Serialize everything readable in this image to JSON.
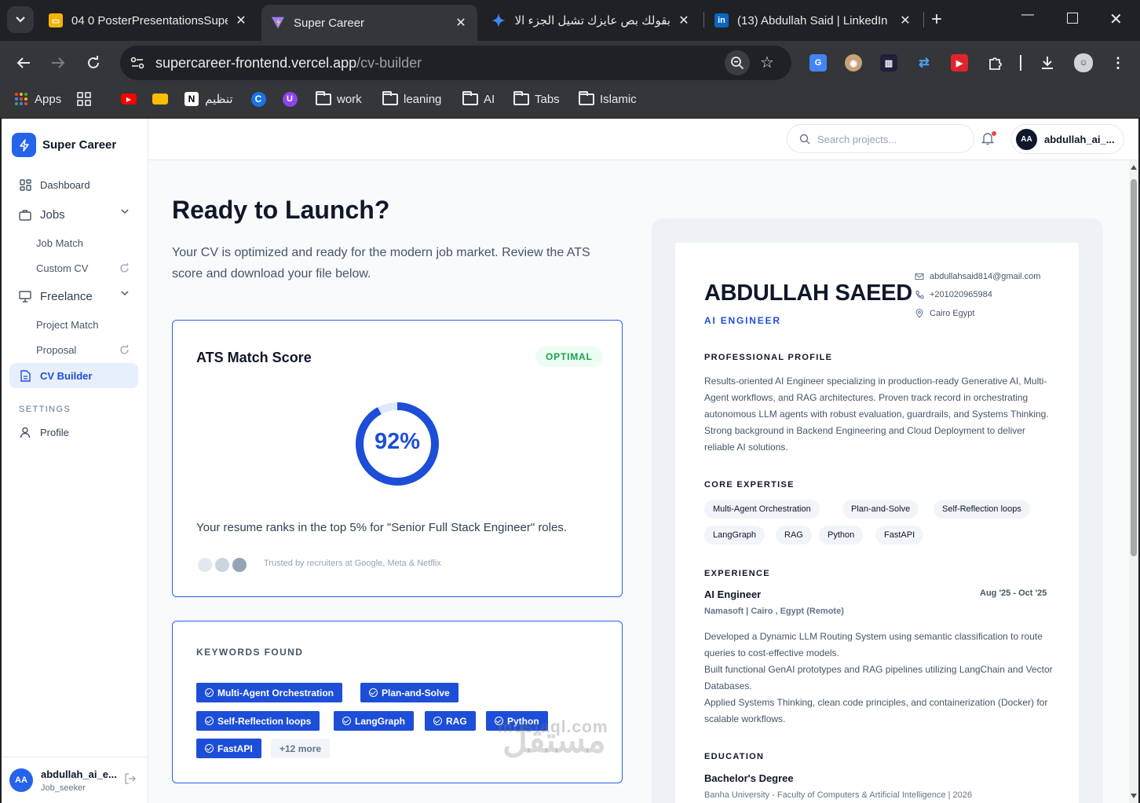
{
  "browser": {
    "tabs": [
      {
        "title": "04 0 PosterPresentationsSupe",
        "favicon": "slides-icon",
        "color": "#f4b400"
      },
      {
        "title": "Super Career",
        "favicon": "vite-icon",
        "color": "#9b7cff"
      },
      {
        "title": "بقولك بص عايزك تشيل الجزء الا",
        "favicon": "gemini-icon",
        "color": "#4285f4"
      },
      {
        "title": "(13) Abdullah Said | LinkedIn",
        "favicon": "linkedin-icon",
        "color": "#0a66c2"
      }
    ],
    "url_host": "supercareer-frontend.vercel.app",
    "url_path": "/cv-builder",
    "bookmarks": {
      "apps": "Apps",
      "notion": "تنظيم",
      "work": "work",
      "leaning": "leaning",
      "ai": "AI",
      "tabs": "Tabs",
      "islamic": "Islamic"
    }
  },
  "sidebar": {
    "brand": "Super Career",
    "items": {
      "dashboard": "Dashboard",
      "jobs": "Jobs",
      "job_match": "Job Match",
      "custom_cv": "Custom CV",
      "freelance": "Freelance",
      "project_match": "Project Match",
      "proposal": "Proposal",
      "cv_builder": "CV Builder",
      "settings": "SETTINGS",
      "profile": "Profile"
    },
    "user": {
      "initials": "AA",
      "name": "abdullah_ai_e...",
      "role": "Job_seeker"
    }
  },
  "topbar": {
    "search_placeholder": "Search projects...",
    "user_initials": "AA",
    "user_name": "abdullah_ai_..."
  },
  "main": {
    "title": "Ready to Launch?",
    "lead": "Your CV is optimized and ready for the modern job market. Review the ATS score and download your file below.",
    "ats": {
      "title": "ATS Match Score",
      "badge": "OPTIMAL",
      "score": 92,
      "score_label": "92%",
      "rank_text": "Your resume ranks in the top 5% for \"Senior Full Stack Engineer\" roles.",
      "trust_text": "Trusted by recruiters at Google, Meta & Netflix"
    },
    "keywords": {
      "title": "KEYWORDS FOUND",
      "items": [
        "Multi-Agent Orchestration",
        "Plan-and-Solve",
        "Self-Reflection loops",
        "LangGraph",
        "RAG",
        "Python",
        "FastAPI"
      ],
      "more": "+12 more"
    }
  },
  "resume": {
    "name": "ABDULLAH SAEED",
    "role": "AI ENGINEER",
    "email": "abdullahsaid814@gmail.com",
    "phone": "+201020965984",
    "location": "Cairo Egypt",
    "profile_heading": "PROFESSIONAL PROFILE",
    "profile_text": "Results-oriented AI Engineer specializing in production-ready Generative AI, Multi-Agent workflows, and RAG architectures. Proven track record in orchestrating autonomous LLM agents with robust evaluation, guardrails, and Systems Thinking. Strong background in Backend Engineering and Cloud Deployment to deliver reliable AI solutions.",
    "expertise_heading": "CORE EXPERTISE",
    "expertise": [
      "Multi-Agent Orchestration",
      "Plan-and-Solve",
      "Self-Reflection loops",
      "LangGraph",
      "RAG",
      "Python",
      "FastAPI"
    ],
    "experience_heading": "EXPERIENCE",
    "job_title": "AI Engineer",
    "job_dates": "Aug '25 - Oct '25",
    "job_company": "Namasoft | Cairo , Egypt (Remote)",
    "job_bullets": [
      "Developed a Dynamic LLM Routing System using semantic classification to route queries to cost-effective models.",
      "Built functional GenAI prototypes and RAG pipelines utilizing LangChain and Vector Databases.",
      "Applied Systems Thinking, clean code principles, and containerization (Docker) for scalable workflows."
    ],
    "education_heading": "EDUCATION",
    "degree": "Bachelor's Degree",
    "school": "Banha University - Faculty of Computers & Artificial Intelligence | 2026"
  },
  "watermark": {
    "arabic": "مستقل",
    "latin": "mostaql.com"
  },
  "colors": {
    "accent": "#2563eb",
    "optimal": "#16a34a"
  }
}
